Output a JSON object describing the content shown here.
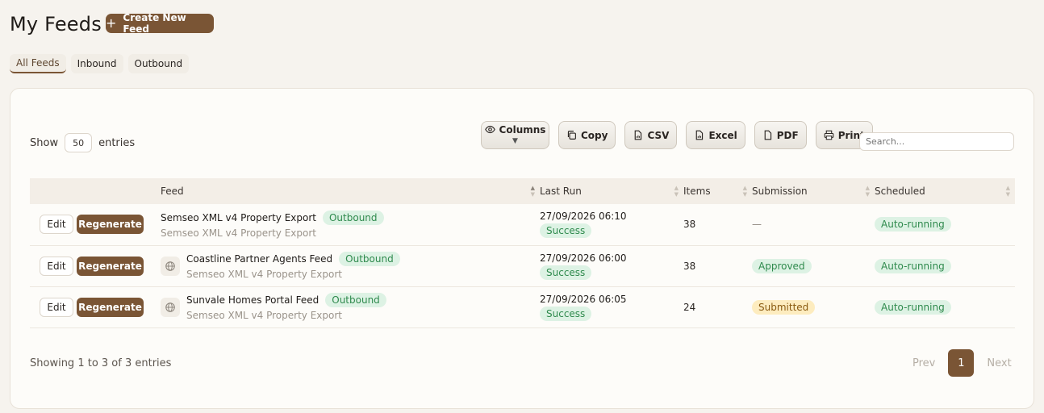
{
  "header": {
    "title": "My Feeds",
    "create_button": "Create New Feed"
  },
  "tabs": [
    {
      "label": "All Feeds",
      "active": true
    },
    {
      "label": "Inbound",
      "active": false
    },
    {
      "label": "Outbound",
      "active": false
    }
  ],
  "controls": {
    "show_label": "Show",
    "entries_value": "50",
    "entries_label": "entries",
    "search_placeholder": "Search...",
    "buttons": {
      "columns": "Columns",
      "copy": "Copy",
      "csv": "CSV",
      "excel": "Excel",
      "pdf": "PDF",
      "print": "Print"
    }
  },
  "table": {
    "headers": {
      "feed": "Feed",
      "last_run": "Last Run",
      "items": "Items",
      "submission": "Submission",
      "scheduled": "Scheduled"
    },
    "row_actions": {
      "edit": "Edit",
      "regenerate": "Regenerate"
    },
    "rows": [
      {
        "name": "Semseo XML v4 Property Export",
        "direction": "Outbound",
        "format": "Semseo XML v4 Property Export",
        "last_run_date": "27/09/2026 06:10",
        "last_run_status": "Success",
        "items": "38",
        "submission": "—",
        "scheduled": "Auto-running"
      },
      {
        "name": "Coastline Partner Agents Feed",
        "direction": "Outbound",
        "format": "Semseo XML v4 Property Export",
        "last_run_date": "27/09/2026 06:00",
        "last_run_status": "Success",
        "items": "38",
        "submission": "Approved",
        "scheduled": "Auto-running"
      },
      {
        "name": "Sunvale Homes Portal Feed",
        "direction": "Outbound",
        "format": "Semseo XML v4 Property Export",
        "last_run_date": "27/09/2026 06:05",
        "last_run_status": "Success",
        "items": "24",
        "submission": "Submitted",
        "scheduled": "Auto-running"
      }
    ]
  },
  "footer": {
    "showing": "Showing 1 to 3 of 3 entries",
    "prev": "Prev",
    "page": "1",
    "next": "Next"
  },
  "colors": {
    "accent": "#7a5535",
    "success_bg": "#ddf2e4",
    "success_text": "#2f8a4d",
    "pending_bg": "#fdecbf",
    "pending_text": "#8a5a10"
  }
}
